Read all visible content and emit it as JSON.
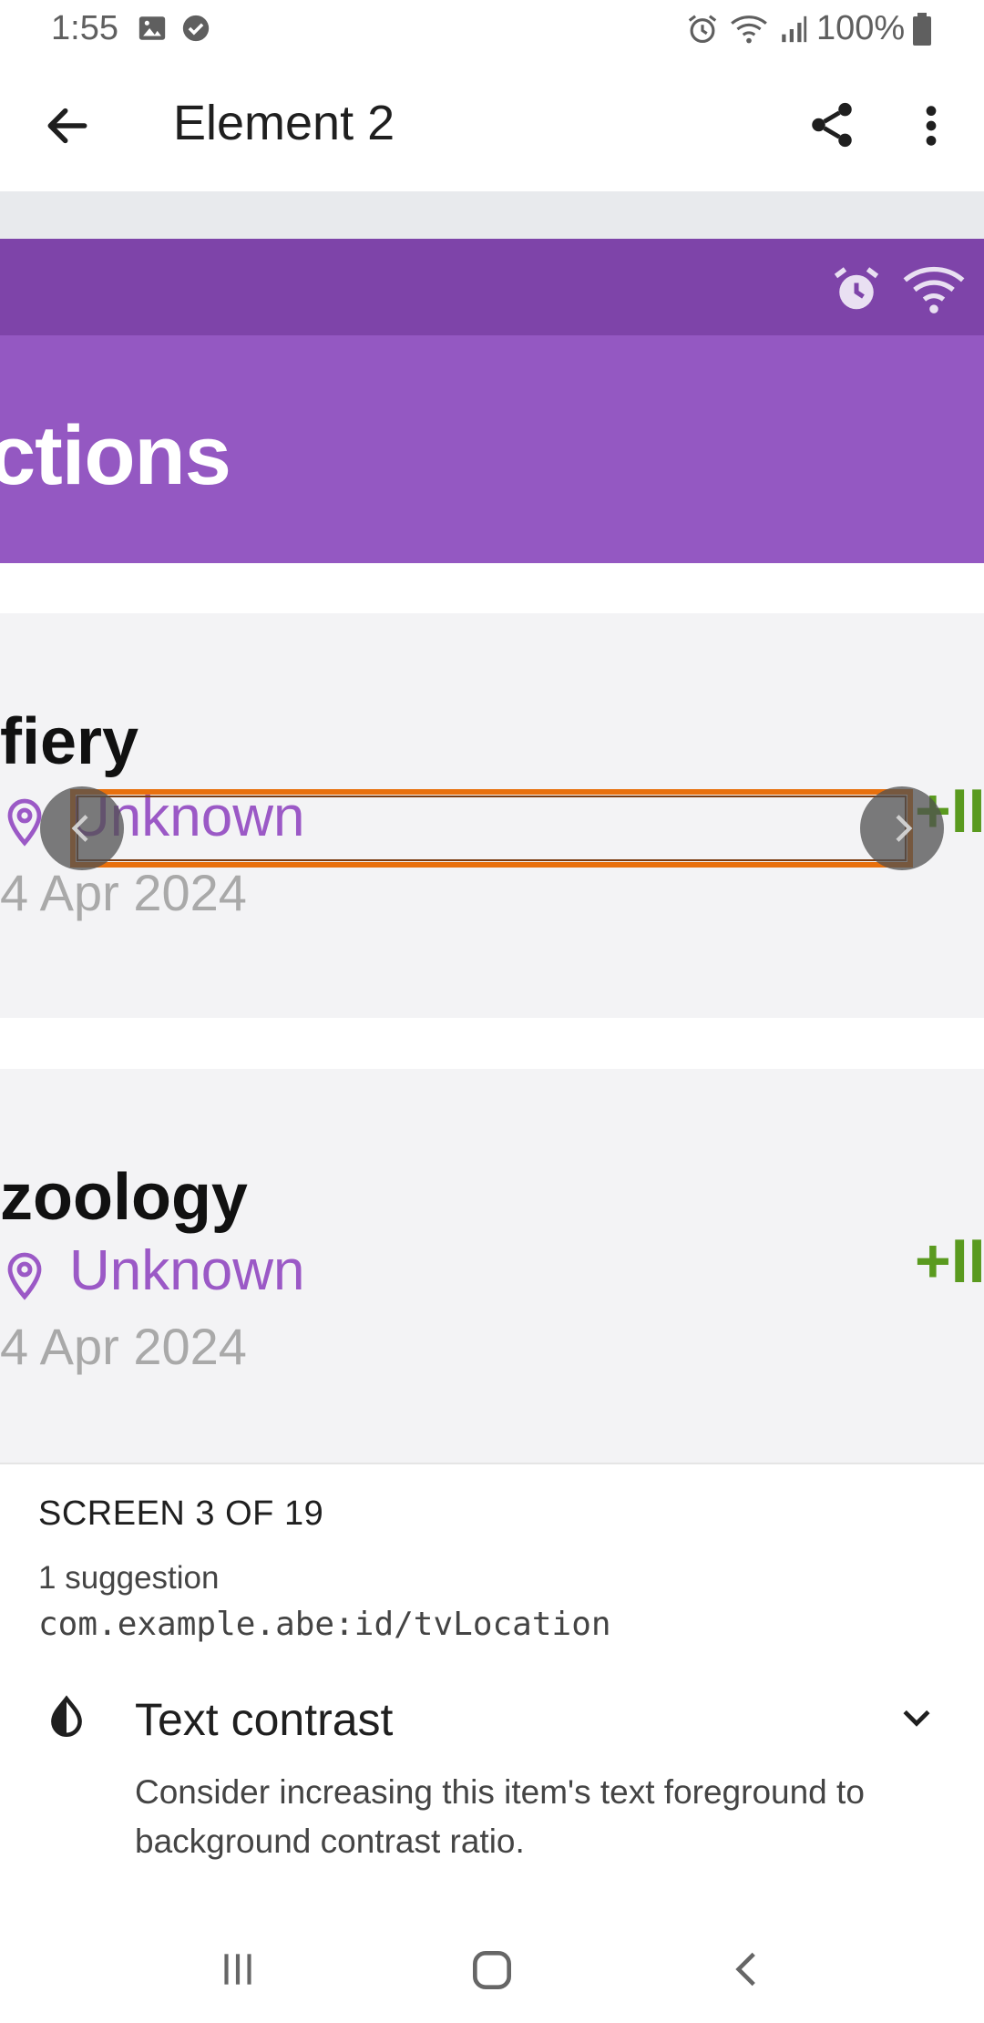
{
  "status_bar": {
    "time": "1:55",
    "battery": "100%"
  },
  "app_bar": {
    "title": "Element 2"
  },
  "screenshot": {
    "header_title": "ctions",
    "cards": [
      {
        "title": "fiery",
        "location": "Unknown",
        "date": "4 Apr 2024",
        "action": "+II"
      },
      {
        "title": "zoology",
        "location": "Unknown",
        "date": "4 Apr 2024",
        "action": "+II"
      }
    ]
  },
  "sheet": {
    "screen_count": "SCREEN 3 OF 19",
    "suggestion_count": "1 suggestion",
    "element_id": "com.example.abe:id/tvLocation",
    "issue_title": "Text contrast",
    "issue_description": "Consider increasing this item's text foreground to background contrast ratio."
  },
  "colors": {
    "accent_purple": "#9458c2",
    "highlight_orange": "#e8700d",
    "plus_green": "#5a9a1f"
  }
}
